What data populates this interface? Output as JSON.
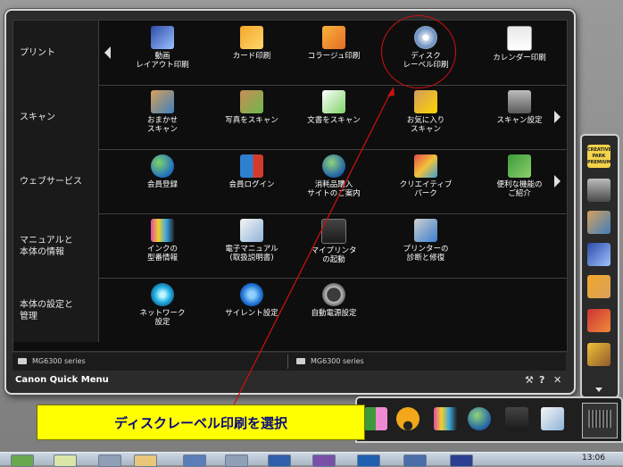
{
  "window": {
    "app_title": "Canon Quick Menu",
    "device_left": "MG6300 series",
    "device_right": "MG6300 series",
    "buttons": {
      "tools": "⚒",
      "help": "?",
      "close": "✕"
    }
  },
  "rows": [
    {
      "label": "プリント",
      "items": [
        {
          "label": "動画\nレイアウト印刷"
        },
        {
          "label": "カード印刷"
        },
        {
          "label": "コラージュ印刷"
        },
        {
          "label": "ディスク\nレーベル印刷"
        },
        {
          "label": "カレンダー印刷"
        }
      ]
    },
    {
      "label": "スキャン",
      "items": [
        {
          "label": "おまかせ\nスキャン"
        },
        {
          "label": "写真をスキャン"
        },
        {
          "label": "文書をスキャン"
        },
        {
          "label": "お気に入り\nスキャン"
        },
        {
          "label": "スキャン設定"
        }
      ]
    },
    {
      "label": "ウェブサービス",
      "items": [
        {
          "label": "会員登録"
        },
        {
          "label": "会員ログイン"
        },
        {
          "label": "消耗品購入\nサイトのご案内"
        },
        {
          "label": "クリエイティブ\nパーク"
        },
        {
          "label": "便利な機能の\nご紹介"
        }
      ]
    },
    {
      "label": "マニュアルと\n本体の情報",
      "items": [
        {
          "label": "インクの\n型番情報"
        },
        {
          "label": "電子マニュアル\n(取扱説明書)"
        },
        {
          "label": "マイプリンタ\nの起動"
        },
        {
          "label": "プリンターの\n診断と修復"
        }
      ]
    },
    {
      "label": "本体の設定と\n管理",
      "items": [
        {
          "label": "ネットワーク\n設定"
        },
        {
          "label": "サイレント設定"
        },
        {
          "label": "自動電源設定"
        }
      ]
    }
  ],
  "side_dock": {
    "creative_park_label": "CREATIVE\nPARK\nPREMIUM"
  },
  "taskbar": {
    "clock": "13:06"
  },
  "annotation": {
    "callout_text": "ディスクレーベル印刷を選択"
  },
  "colors": {
    "window_bg": "#0e0e0e",
    "row_label_bg": "#1a1a1a",
    "callout_yellow": "#ffff00",
    "callout_text": "#0a0a7a",
    "annotation_red": "#d01010"
  },
  "icons": {
    "print": [
      "movie-layout-icon",
      "card-print-icon",
      "collage-icon",
      "disc-label-icon",
      "calendar-icon"
    ],
    "scan": [
      "auto-scan-icon",
      "photo-scan-icon",
      "document-scan-icon",
      "favorite-scan-icon",
      "scan-settings-icon"
    ],
    "web": [
      "member-register-icon",
      "member-login-icon",
      "supplies-cart-icon",
      "creative-park-icon",
      "useful-features-icon"
    ],
    "manual": [
      "ink-info-icon",
      "e-manual-icon",
      "my-printer-icon",
      "printer-diagnose-icon"
    ],
    "settings": [
      "network-settings-icon",
      "silent-settings-icon",
      "auto-power-icon"
    ]
  }
}
